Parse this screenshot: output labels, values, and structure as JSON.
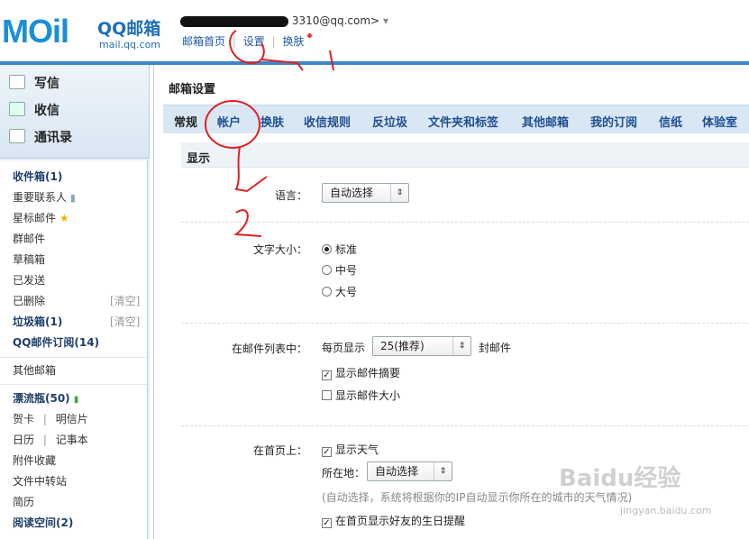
{
  "logo": {
    "mark": "MOil",
    "name": "QQ邮箱",
    "domain": "mail.qq.com"
  },
  "header": {
    "account": "3310@qq.com>",
    "caret": "▾",
    "nav_home": "邮箱首页",
    "sep": "|",
    "nav_settings": "设置",
    "nav_skin": "换肤"
  },
  "sidebar": {
    "compose": "写信",
    "inbox": "收信",
    "contacts": "通讯录",
    "folders": {
      "inbox": "收件箱(1)",
      "vip": "重要联系人",
      "starred": "星标邮件",
      "group": "群邮件",
      "drafts": "草稿箱",
      "sent": "已发送",
      "deleted": "已删除",
      "deleted_clear": "[清空]",
      "spam": "垃圾箱(1)",
      "spam_clear": "[清空]",
      "subscribe": "QQ邮件订阅(14)",
      "other": "其他邮箱",
      "drift": "漂流瓶(50)",
      "card": "贺卡",
      "postcard": "明信片",
      "calendar": "日历",
      "notebook": "记事本",
      "attachments": "附件收藏",
      "transfer": "文件中转站",
      "resume": "简历",
      "reading": "阅读空间(2)",
      "bar": "|"
    }
  },
  "main": {
    "title": "邮箱设置",
    "tabs": [
      "常规",
      "帐户",
      "换肤",
      "收信规则",
      "反垃圾",
      "文件夹和标签",
      "其他邮箱",
      "我的订阅",
      "信纸",
      "体验室"
    ],
    "section": "显示",
    "language_label": "语言：",
    "language_value": "自动选择",
    "font_label": "文字大小：",
    "font_options": [
      "标准",
      "中号",
      "大号"
    ],
    "list_label": "在邮件列表中：",
    "per_page_prefix": "每页显示",
    "per_page_value": "25(推荐)",
    "per_page_suffix": "封邮件",
    "show_summary": "显示邮件摘要",
    "show_size": "显示邮件大小",
    "home_label": "在首页上：",
    "show_weather": "显示天气",
    "location_label": "所在地：",
    "location_value": "自动选择",
    "location_note": "(自动选择，系统将根据你的IP自动显示你所在的城市的天气情况)",
    "birthday": "在首页显示好友的生日提醒"
  },
  "watermark": {
    "brand": "Baidu经验",
    "url": "jingyan.baidu.com"
  },
  "colors": {
    "accent": "#3b86cb",
    "link": "#1e5aa6",
    "annotation": "#e02020"
  }
}
